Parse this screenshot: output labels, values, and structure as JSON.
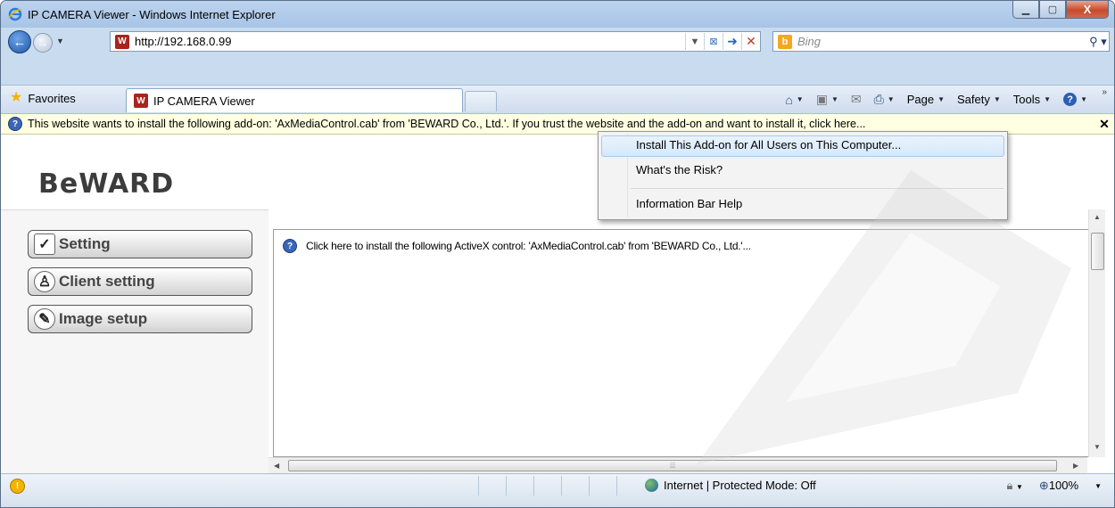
{
  "window": {
    "title": "IP CAMERA Viewer - Windows Internet Explorer",
    "minimize_glyph": "▁",
    "maximize_glyph": "▢",
    "close_glyph": "X"
  },
  "nav": {
    "url": "http://192.168.0.99",
    "search_placeholder": "Bing",
    "site_icon_glyph": "W",
    "bing_icon_glyph": "b"
  },
  "command_bar": {
    "favorites_label": "Favorites",
    "tab_label": "IP CAMERA Viewer",
    "page_label": "Page",
    "safety_label": "Safety",
    "tools_label": "Tools"
  },
  "info_bar": {
    "message": "This website wants to install the following add-on: 'AxMediaControl.cab' from 'BEWARD Co., Ltd.'. If you trust the website and the add-on and want to install it, click here...",
    "close_glyph": "✕"
  },
  "context_menu": {
    "items": [
      {
        "label": "Install This Add-on for All Users on This Computer..."
      },
      {
        "label": "What's the Risk?"
      },
      {
        "label": "Information Bar Help"
      }
    ]
  },
  "page": {
    "logo": "BeWARD",
    "sidebar": [
      {
        "label": "Setting",
        "icon": "check-icon",
        "glyph": "✓"
      },
      {
        "label": "Client setting",
        "icon": "user-icon",
        "glyph": "♙"
      },
      {
        "label": "Image setup",
        "icon": "brush-icon",
        "glyph": "✎"
      }
    ],
    "activex_message": "Click here to install the following ActiveX control: 'AxMediaControl.cab' from 'BEWARD Co., Ltd.'..."
  },
  "status_bar": {
    "zone": "Internet | Protected Mode: Off",
    "zoom": "100%"
  }
}
